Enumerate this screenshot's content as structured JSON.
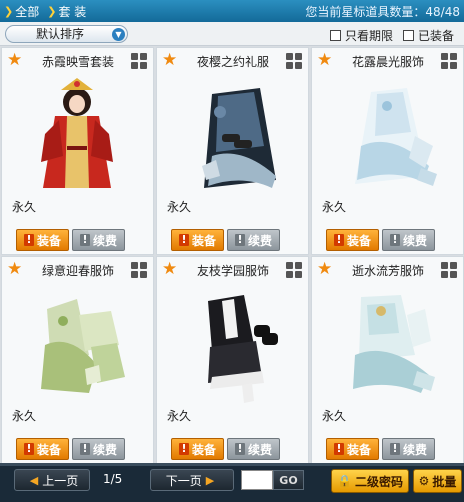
{
  "header": {
    "breadcrumbs": [
      "全部",
      "套 装"
    ],
    "star_count": "您当前星标道具数量：48/48"
  },
  "filters": {
    "sort_label": "默认排序",
    "only_expiring": "只看期限",
    "equipped": "已装备"
  },
  "items": [
    {
      "name": "赤霞映雪套装",
      "term": "永久",
      "equip": "装备",
      "renew": "续费"
    },
    {
      "name": "夜樱之约礼服",
      "term": "永久",
      "equip": "装备",
      "renew": "续费"
    },
    {
      "name": "花露晨光服饰",
      "term": "永久",
      "equip": "装备",
      "renew": "续费"
    },
    {
      "name": "绿意迎春服饰",
      "term": "永久",
      "equip": "装备",
      "renew": "续费"
    },
    {
      "name": "友枝学园服饰",
      "term": "永久",
      "equip": "装备",
      "renew": "续费"
    },
    {
      "name": "逝水流芳服饰",
      "term": "永久",
      "equip": "装备",
      "renew": "续费"
    }
  ],
  "pager": {
    "prev": "上一页",
    "page": "1/5",
    "next": "下一页",
    "go": "GO",
    "password": "二级密码",
    "batch": "批量"
  },
  "icons": {
    "star": "favorite-star-icon",
    "view": "grid-view-icon",
    "lock": "lock-icon",
    "gear": "gear-icon"
  },
  "colors": {
    "accent": "#136a99",
    "equip": "#e27a00",
    "renew": "#8c959c",
    "star": "#f08a10"
  }
}
